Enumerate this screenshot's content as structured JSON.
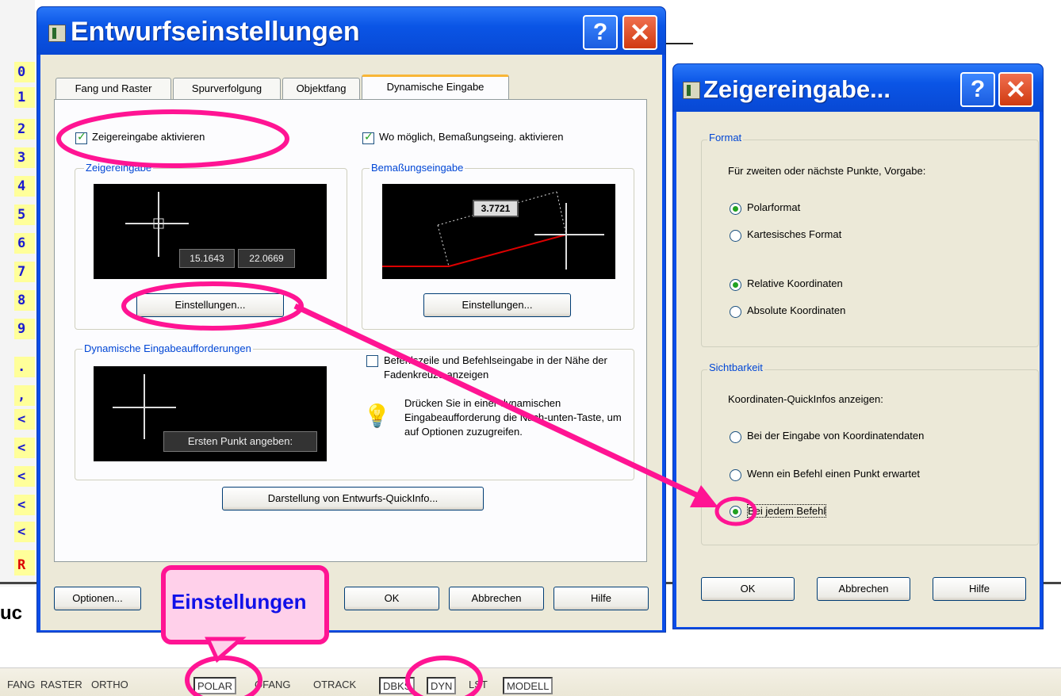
{
  "left_toolbar": {
    "items": [
      "0",
      "1",
      "2",
      "3",
      "4",
      "5",
      "6",
      "7",
      "8",
      "9",
      ".",
      ",",
      "<",
      "<",
      "<",
      "<",
      "<",
      "<",
      "R"
    ]
  },
  "behind_text": "uc",
  "main_dialog": {
    "title": "Entwurfseinstellungen",
    "help": "?",
    "close": "✕",
    "tabs": [
      "Fang und Raster",
      "Spurverfolgung",
      "Objektfang",
      "Dynamische Eingabe"
    ],
    "active_tab": "Dynamische Eingabe",
    "pointer_enable": "Zeigereingabe aktivieren",
    "dim_enable": "Wo möglich, Bemaßungseing. aktivieren",
    "pointer_group": "Zeigereingabe",
    "dim_group": "Bemaßungseingabe",
    "pointer_x": "15.1643",
    "pointer_y": "22.0669",
    "dim_value": "3.7721",
    "settings_btn1": "Einstellungen...",
    "settings_btn2": "Einstellungen...",
    "prompts_group": "Dynamische Eingabeaufforderungen",
    "prompt_text": "Ersten Punkt angeben:",
    "cmdline_label": "Befehlszeile und Befehlseingabe in der Nähe der Fadenkreuze anzeigen",
    "tip_text": "Drücken Sie in einer dynamischen Eingabeaufforderung die Nach-unten-Taste, um auf Optionen zuzugreifen.",
    "quickinfo_btn": "Darstellung von Entwurfs-QuickInfo...",
    "options_btn": "Optionen...",
    "ok_btn": "OK",
    "cancel_btn": "Abbrechen",
    "help_btn": "Hilfe"
  },
  "callout": {
    "text": "Einstellungen"
  },
  "pointer_dialog": {
    "title": "Zeigereingabe...",
    "help": "?",
    "close": "✕",
    "format_group": "Format",
    "format_desc": "Für zweiten oder nächste Punkte, Vorgabe:",
    "polar": "Polarformat",
    "cartesian": "Kartesisches Format",
    "relative": "Relative Koordinaten",
    "absolute": "Absolute Koordinaten",
    "visibility_group": "Sichtbarkeit",
    "visibility_desc": "Koordinaten-QuickInfos anzeigen:",
    "vis1": "Bei der Eingabe von Koordinatendaten",
    "vis2": "Wenn ein Befehl einen Punkt erwartet",
    "vis3": "Bei jedem Befehl",
    "ok_btn": "OK",
    "cancel_btn": "Abbrechen",
    "help_btn": "Hilfe"
  },
  "statusbar": {
    "items": [
      "FANG",
      "RASTER",
      "ORTHO",
      "POLAR",
      "OFANG",
      "OTRACK",
      "DBKS",
      "DYN",
      "LST",
      "MODELL"
    ]
  },
  "colors": {
    "accent": "#ff1493",
    "xp_blue": "#0a4de8",
    "dialog_bg": "#ece9d8",
    "group_label": "#0046d5"
  }
}
